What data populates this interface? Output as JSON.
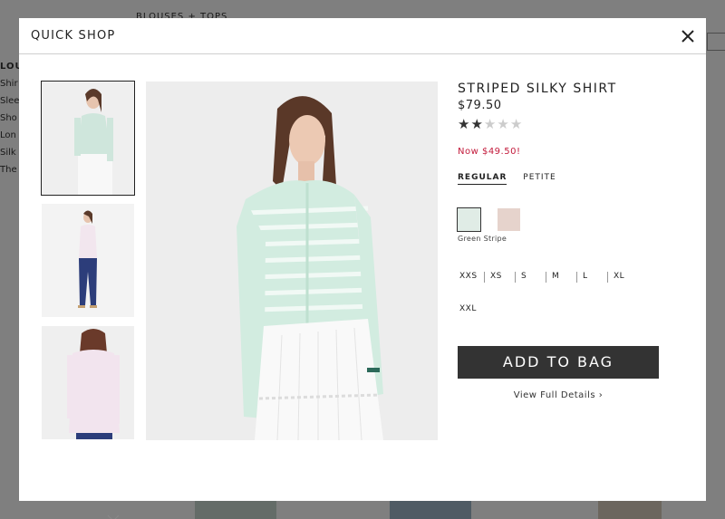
{
  "background": {
    "category": "BLOUSES + TOPS",
    "sidebar_heading": "LOU",
    "sidebar_items": [
      "Shir",
      "Slee",
      "Sho",
      "Lon",
      "Silk",
      "The"
    ]
  },
  "modal": {
    "title": "QUICK SHOP",
    "close_label": "✕"
  },
  "product": {
    "name": "STRIPED SILKY SHIRT",
    "price": "$79.50",
    "rating": 2,
    "rating_max": 5,
    "sale_price": "Now $49.50!",
    "fits": [
      {
        "label": "REGULAR",
        "active": true
      },
      {
        "label": "PETITE",
        "active": false
      }
    ],
    "colors": [
      {
        "name": "Green Stripe",
        "hex": "#e0ece6",
        "selected": true
      },
      {
        "name": "",
        "hex": "#e6d3cc",
        "selected": false
      }
    ],
    "selected_color_label": "Green Stripe",
    "sizes_row1": [
      "XXS",
      "XS",
      "S",
      "M",
      "L",
      "XL"
    ],
    "sizes_row2": [
      "XXL"
    ],
    "add_to_bag": "ADD TO BAG",
    "view_details": "View Full Details ›"
  },
  "colors": {
    "accent_sale": "#c31a3b",
    "button_bg": "#333333",
    "overlay": "rgba(0,0,0,0.5)"
  }
}
